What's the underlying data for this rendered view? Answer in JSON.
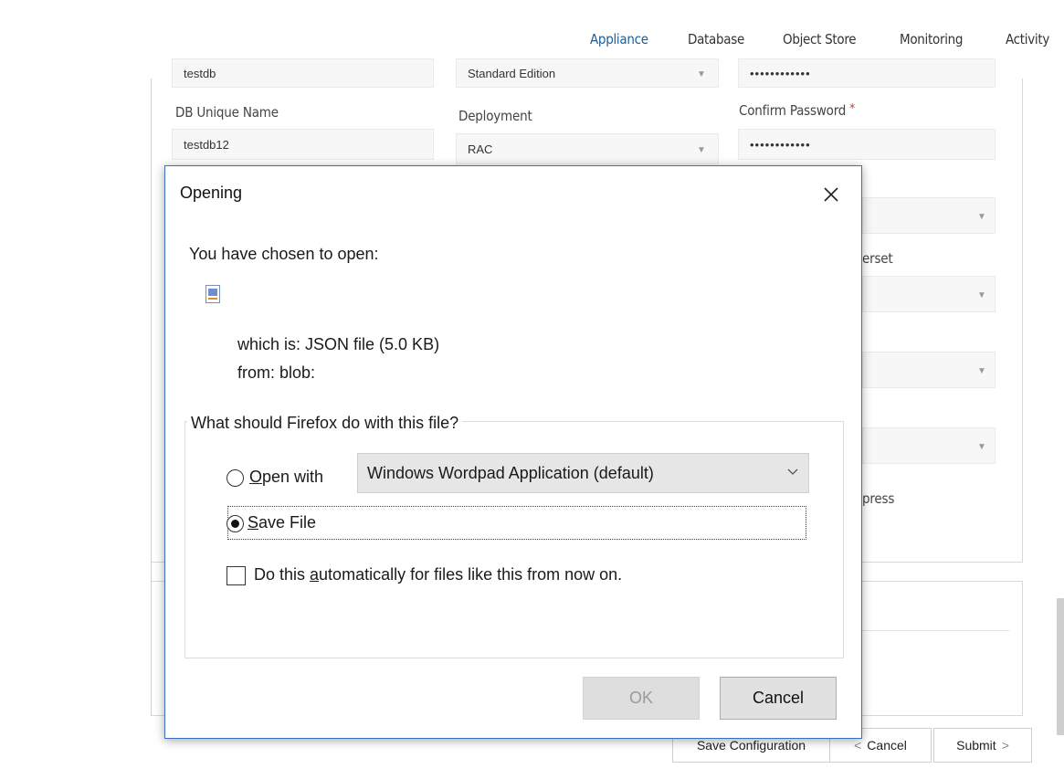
{
  "nav": {
    "tabs": [
      {
        "label": "Appliance",
        "active": true
      },
      {
        "label": "Database"
      },
      {
        "label": "Object Store"
      },
      {
        "label": "Monitoring"
      },
      {
        "label": "Activity"
      }
    ]
  },
  "form": {
    "db_name_value": "testdb",
    "edition_value": "Standard Edition",
    "password_value": "••••••••••••",
    "db_unique_name_label": "DB Unique Name",
    "db_unique_name_value": "testdb12",
    "deployment_label": "Deployment",
    "deployment_value": "RAC",
    "confirm_password_label": "Confirm Password",
    "confirm_password_required": "*",
    "confirm_password_value": "••••••••••••",
    "partial_label_charset": "erset",
    "partial_label_compress": "press"
  },
  "footer": {
    "save_config_label": "Save Configuration",
    "cancel_label": "Cancel",
    "submit_label": "Submit"
  },
  "dialog": {
    "title": "Opening",
    "intro": "You have chosen to open:",
    "which_is": "which is:  JSON file (5.0 KB)",
    "from": "from:  blob:",
    "question": "What should Firefox do with this file?",
    "open_with_prefix": "O",
    "open_with_rest": "pen with",
    "open_with_selected": false,
    "app_selected": "Windows Wordpad Application (default)",
    "save_file_prefix": "S",
    "save_file_rest": "ave File",
    "save_file_selected": true,
    "auto_pre": "Do this ",
    "auto_underline": "a",
    "auto_post": "utomatically for files like this from now on.",
    "auto_checked": false,
    "ok_label": "OK",
    "cancel_label": "Cancel"
  },
  "icons": {
    "close": "close-icon",
    "file": "json-file-icon",
    "chevron": "chevron-down-icon"
  }
}
